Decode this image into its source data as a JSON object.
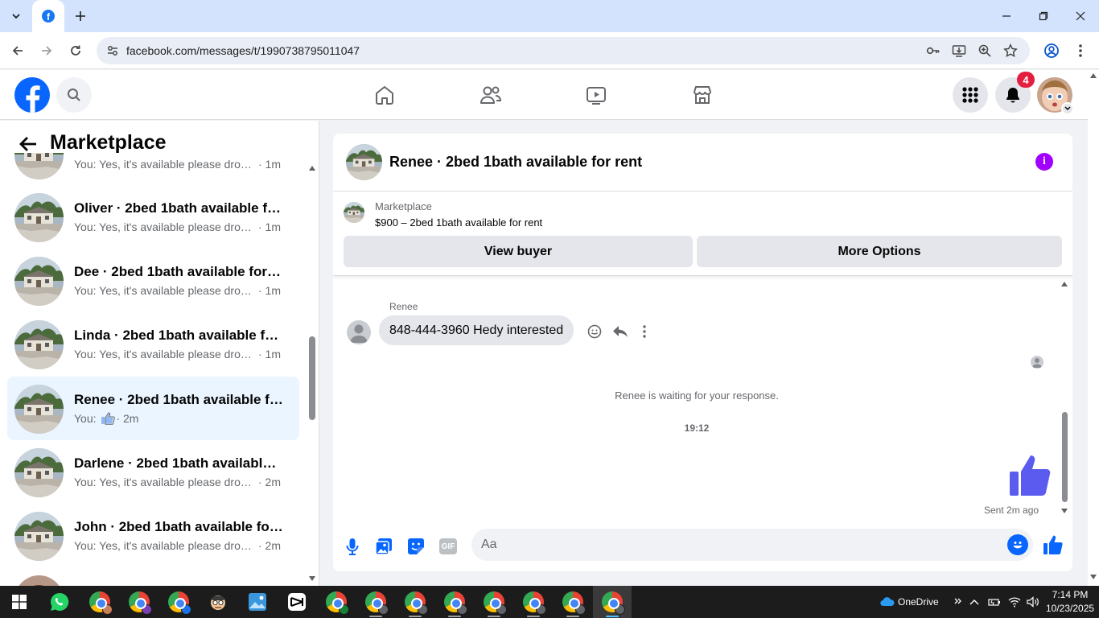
{
  "browser": {
    "url": "facebook.com/messages/t/1990738795011047"
  },
  "header": {
    "notification_count": "4"
  },
  "left_panel": {
    "title": "Marketplace",
    "conversations": [
      {
        "name": "",
        "snippet": "You: Yes, it's available please drop ...",
        "time": " · 1m"
      },
      {
        "name": "Oliver · 2bed 1bath available for ...",
        "snippet": "You: Yes, it's available please drop ...",
        "time": " · 1m"
      },
      {
        "name": "Dee · 2bed 1bath available for rent",
        "snippet": "You: Yes, it's available please drop ...",
        "time": " · 1m"
      },
      {
        "name": "Linda · 2bed 1bath available for r...",
        "snippet": "You: Yes, it's available please drop ...",
        "time": " · 1m"
      },
      {
        "name": "Renee · 2bed 1bath available for ...",
        "snippet": "You: ",
        "time": " · 2m"
      },
      {
        "name": "Darlene · 2bed 1bath available fo...",
        "snippet": "You: Yes, it's available please drop ...",
        "time": " · 2m"
      },
      {
        "name": "John · 2bed 1bath available for r...",
        "snippet": "You: Yes, it's available please drop ...",
        "time": " · 2m"
      },
      {
        "name": "",
        "snippet": "",
        "time": ""
      }
    ]
  },
  "chat": {
    "title": "Renee · 2bed 1bath available for rent",
    "marketplace_label": "Marketplace",
    "listing": "$900 – 2bed 1bath available for rent",
    "view_buyer_label": "View buyer",
    "more_options_label": "More Options",
    "sender": "Renee",
    "message": "848-444-3960 Hedy interested",
    "waiting_text": "Renee is waiting for your response.",
    "timestamp": "19:12",
    "sent_note": "Sent 2m ago",
    "composer_placeholder": "Aa",
    "gif_label": "GIF"
  },
  "taskbar": {
    "onedrive_label": "OneDrive",
    "time": "7:14 PM",
    "date": "10/23/2025"
  },
  "colors": {
    "brand": "#0866ff",
    "active_conv": "#ebf5ff",
    "info": "#a200ff",
    "like": "#5b5bf0"
  }
}
